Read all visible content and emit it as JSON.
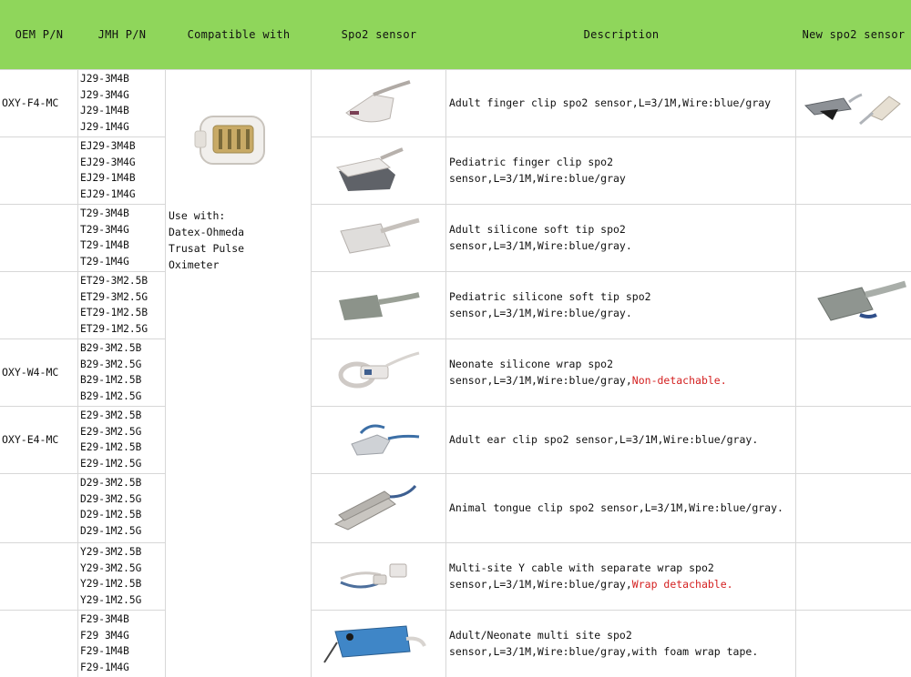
{
  "headers": {
    "oem": "OEM P/N",
    "jmh": "JMH P/N",
    "compat": "Compatible with",
    "sensor": "Spo2 sensor",
    "desc": "Description",
    "new": "New spo2 sensor"
  },
  "compat_text": [
    "Use with:",
    "Datex-Ohmeda",
    "Trusat Pulse",
    "Oximeter"
  ],
  "rows": [
    {
      "oem": "OXY-F4-MC",
      "pn": [
        "J29-3M4B",
        "J29-3M4G",
        "J29-1M4B",
        "J29-1M4G"
      ],
      "desc": [
        "Adult finger clip spo2 sensor,L=3/1M,Wire:blue/gray"
      ],
      "red": ""
    },
    {
      "oem": "",
      "pn": [
        "EJ29-3M4B",
        "EJ29-3M4G",
        "EJ29-1M4B",
        "EJ29-1M4G"
      ],
      "desc": [
        "Pediatric finger clip spo2 sensor,L=3/1M,Wire:blue/gray"
      ],
      "red": ""
    },
    {
      "oem": "",
      "pn": [
        "T29-3M4B",
        "T29-3M4G",
        "T29-1M4B",
        "T29-1M4G"
      ],
      "desc": [
        "Adult silicone soft tip spo2",
        "sensor,L=3/1M,Wire:blue/gray."
      ],
      "red": ""
    },
    {
      "oem": "",
      "pn": [
        "ET29-3M2.5B",
        "ET29-3M2.5G",
        "ET29-1M2.5B",
        "ET29-1M2.5G"
      ],
      "desc": [
        "Pediatric silicone soft tip spo2",
        "sensor,L=3/1M,Wire:blue/gray."
      ],
      "red": ""
    },
    {
      "oem": "OXY-W4-MC",
      "pn": [
        "B29-3M2.5B",
        "B29-3M2.5G",
        "B29-1M2.5B",
        "B29-1M2.5G"
      ],
      "desc": [
        "Neonate silicone wrap spo2",
        "sensor,L=3/1M,Wire:blue/gray,"
      ],
      "red": "Non-detachable."
    },
    {
      "oem": "OXY-E4-MC",
      "pn": [
        "E29-3M2.5B",
        "E29-3M2.5G",
        "E29-1M2.5B",
        "E29-1M2.5G"
      ],
      "desc": [
        "Adult ear clip spo2 sensor,L=3/1M,Wire:blue/gray."
      ],
      "red": ""
    },
    {
      "oem": "",
      "pn": [
        "D29-3M2.5B",
        "D29-3M2.5G",
        "D29-1M2.5B",
        "D29-1M2.5G"
      ],
      "desc": [
        "Animal tongue clip spo2 sensor,L=3/1M,Wire:blue/gray."
      ],
      "red": ""
    },
    {
      "oem": "",
      "pn": [
        "Y29-3M2.5B",
        "Y29-3M2.5G",
        "Y29-1M2.5B",
        "Y29-1M2.5G"
      ],
      "desc": [
        "Multi-site Y cable with separate wrap spo2",
        "sensor,L=3/1M,Wire:blue/gray,"
      ],
      "red": "Wrap detachable."
    },
    {
      "oem": "",
      "pn": [
        "F29-3M4B",
        "F29 3M4G",
        "F29-1M4B",
        "F29-1M4G"
      ],
      "desc": [
        "Adult/Neonate multi site spo2",
        "sensor,L=3/1M,Wire:blue/gray,with foam wrap tape."
      ],
      "red": ""
    }
  ],
  "colors": {
    "header": "#8fd65b",
    "grid": "#d7d7d7",
    "accent_red": "#d42020"
  }
}
